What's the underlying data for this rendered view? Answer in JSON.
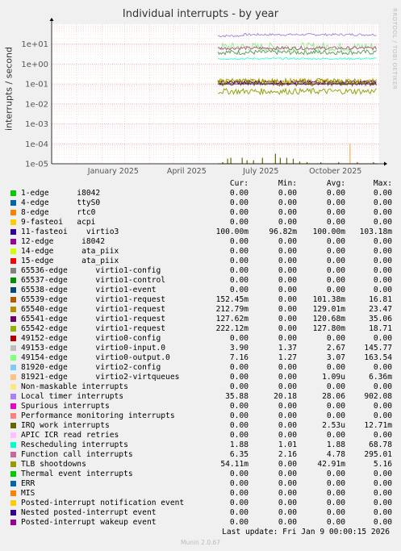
{
  "page": {
    "title": "Individual interrupts - by year",
    "side_text": "RRDTOOL / TOBI OETIKER",
    "ylabel": "interrupts / second",
    "last_update": "Last update: Fri Jan  9 00:00:15 2026",
    "footer": "Munin 2.0.67"
  },
  "chart_data": {
    "type": "line",
    "title": "Individual interrupts - by year",
    "ylabel": "interrupts / second",
    "y_scale": "log",
    "ylim": [
      1e-05,
      100
    ],
    "y_ticks": [
      "1e+01",
      "1e+00",
      "1e-01",
      "1e-02",
      "1e-03",
      "1e-04",
      "1e-05"
    ],
    "x_ticks": [
      "January 2025",
      "April 2025",
      "July 2025",
      "October 2025"
    ],
    "x_range": [
      "2024-12-01",
      "2026-01-09"
    ],
    "data_start": "2025-06-24",
    "grid": true,
    "series": [
      {
        "name": "Local timer interrupts",
        "color": "#a080e0",
        "level": 30,
        "spread": 0.06,
        "start_level": 26
      },
      {
        "name": "virtio0-input.0",
        "color": "#559955",
        "level": 3.9,
        "spread": 0.12
      },
      {
        "name": "virtio0-output.0",
        "color": "#88ee88",
        "level": 7.2,
        "spread": 0.22
      },
      {
        "name": "Function call interrupts",
        "color": "#b05080",
        "level": 6.3,
        "spread": 0.08
      },
      {
        "name": "Rescheduling interrupts",
        "color": "#33ffcc",
        "level": 1.88,
        "spread": 0.05
      },
      {
        "name": "virtio1-request 65539",
        "color": "#a05000",
        "level": 0.11,
        "spread": 0.14
      },
      {
        "name": "virtio1-request 65540",
        "color": "#c8a000",
        "level": 0.13,
        "spread": 0.16
      },
      {
        "name": "virtio1-request 65541",
        "color": "#550077",
        "level": 0.12,
        "spread": 0.1
      },
      {
        "name": "virtio1-request 65542",
        "color": "#88a000",
        "level": 0.13,
        "spread": 0.16
      },
      {
        "name": "11-fasteoi virtio3",
        "color": "#2a0088",
        "level": 0.1,
        "spread": 0.0
      },
      {
        "name": "TLB shootdowns",
        "color": "#88a000",
        "level": 0.043,
        "spread": 0.15
      }
    ],
    "spikes": {
      "color": "#666600",
      "base": 1e-05,
      "events": [
        {
          "date": "2025-06-30",
          "value": 1.2e-05
        },
        {
          "date": "2025-07-06",
          "value": 1.8e-05
        },
        {
          "date": "2025-07-10",
          "value": 2e-05
        },
        {
          "date": "2025-07-24",
          "value": 2e-05
        },
        {
          "date": "2025-07-30",
          "value": 1.5e-05
        },
        {
          "date": "2025-08-07",
          "value": 1.5e-05
        },
        {
          "date": "2025-08-18",
          "value": 2e-05
        },
        {
          "date": "2025-09-03",
          "value": 3.2e-05
        },
        {
          "date": "2025-09-09",
          "value": 2e-05
        },
        {
          "date": "2025-09-17",
          "value": 2e-05
        },
        {
          "date": "2025-09-25",
          "value": 1.8e-05
        },
        {
          "date": "2025-10-03",
          "value": 1.3e-05
        },
        {
          "date": "2025-10-12",
          "value": 1.2e-05
        },
        {
          "date": "2025-10-29",
          "value": 1.2e-05
        },
        {
          "date": "2025-11-20",
          "value": 1.2e-05
        },
        {
          "date": "2025-12-13",
          "value": 1.2e-05
        },
        {
          "date": "2026-01-02",
          "value": 1.2e-05
        }
      ],
      "orange_spike": {
        "date": "2025-12-04",
        "value": 0.0001,
        "color": "#ffaa55"
      }
    }
  },
  "legend": {
    "headers": {
      "cur": "Cur:",
      "min": "Min:",
      "avg": "Avg:",
      "max": "Max:"
    },
    "rows": [
      {
        "color": "#00cc00",
        "label": "1-edge      i8042",
        "cur": "0.00",
        "min": "0.00",
        "avg": "0.00",
        "max": "0.00"
      },
      {
        "color": "#0066b3",
        "label": "4-edge      ttyS0",
        "cur": "0.00",
        "min": "0.00",
        "avg": "0.00",
        "max": "0.00"
      },
      {
        "color": "#ff8000",
        "label": "8-edge      rtc0",
        "cur": "0.00",
        "min": "0.00",
        "avg": "0.00",
        "max": "0.00"
      },
      {
        "color": "#ffcc00",
        "label": "9-fasteoi   acpi",
        "cur": "0.00",
        "min": "0.00",
        "avg": "0.00",
        "max": "0.00"
      },
      {
        "color": "#330099",
        "label": "11-fasteoi    virtio3",
        "cur": "100.00m",
        "min": "96.82m",
        "avg": "100.00m",
        "max": "103.18m"
      },
      {
        "color": "#990099",
        "label": "12-edge      i8042",
        "cur": "0.00",
        "min": "0.00",
        "avg": "0.00",
        "max": "0.00"
      },
      {
        "color": "#ccff00",
        "label": "14-edge      ata_piix",
        "cur": "0.00",
        "min": "0.00",
        "avg": "0.00",
        "max": "0.00"
      },
      {
        "color": "#ff0000",
        "label": "15-edge      ata_piix",
        "cur": "0.00",
        "min": "0.00",
        "avg": "0.00",
        "max": "0.00"
      },
      {
        "color": "#808080",
        "label": "65536-edge      virtio1-config",
        "cur": "0.00",
        "min": "0.00",
        "avg": "0.00",
        "max": "0.00"
      },
      {
        "color": "#008f00",
        "label": "65537-edge      virtio1-control",
        "cur": "0.00",
        "min": "0.00",
        "avg": "0.00",
        "max": "0.00"
      },
      {
        "color": "#00487d",
        "label": "65538-edge      virtio1-event",
        "cur": "0.00",
        "min": "0.00",
        "avg": "0.00",
        "max": "0.00"
      },
      {
        "color": "#b35a00",
        "label": "65539-edge      virtio1-request",
        "cur": "152.45m",
        "min": "0.00",
        "avg": "101.38m",
        "max": "16.81"
      },
      {
        "color": "#b38f00",
        "label": "65540-edge      virtio1-request",
        "cur": "212.79m",
        "min": "0.00",
        "avg": "129.01m",
        "max": "23.47"
      },
      {
        "color": "#6b006b",
        "label": "65541-edge      virtio1-request",
        "cur": "127.62m",
        "min": "0.00",
        "avg": "120.68m",
        "max": "35.06"
      },
      {
        "color": "#8fb300",
        "label": "65542-edge      virtio1-request",
        "cur": "222.12m",
        "min": "0.00",
        "avg": "127.80m",
        "max": "18.71"
      },
      {
        "color": "#b30000",
        "label": "49152-edge      virtio0-config",
        "cur": "0.00",
        "min": "0.00",
        "avg": "0.00",
        "max": "0.00"
      },
      {
        "color": "#bebebe",
        "label": "49153-edge      virtio0-input.0",
        "cur": "3.90",
        "min": "1.37",
        "avg": "2.67",
        "max": "145.77"
      },
      {
        "color": "#80ff80",
        "label": "49154-edge      virtio0-output.0",
        "cur": "7.16",
        "min": "1.27",
        "avg": "3.07",
        "max": "163.54"
      },
      {
        "color": "#80c9ff",
        "label": "81920-edge      virtio2-config",
        "cur": "0.00",
        "min": "0.00",
        "avg": "0.00",
        "max": "0.00"
      },
      {
        "color": "#ffc080",
        "label": "81921-edge      virtio2-virtqueues",
        "cur": "0.00",
        "min": "0.00",
        "avg": "1.09u",
        "max": "6.36m"
      },
      {
        "color": "#ffe680",
        "label": "Non-maskable interrupts",
        "cur": "0.00",
        "min": "0.00",
        "avg": "0.00",
        "max": "0.00"
      },
      {
        "color": "#aa80ff",
        "label": "Local timer interrupts",
        "cur": "35.88",
        "min": "20.18",
        "avg": "28.06",
        "max": "902.08"
      },
      {
        "color": "#ee00cc",
        "label": "Spurious interrupts",
        "cur": "0.00",
        "min": "0.00",
        "avg": "0.00",
        "max": "0.00"
      },
      {
        "color": "#ff8080",
        "label": "Performance monitoring interrupts",
        "cur": "0.00",
        "min": "0.00",
        "avg": "0.00",
        "max": "0.00"
      },
      {
        "color": "#666600",
        "label": "IRQ work interrupts",
        "cur": "0.00",
        "min": "0.00",
        "avg": "2.53u",
        "max": "12.71m"
      },
      {
        "color": "#ffbfff",
        "label": "APIC ICR read retries",
        "cur": "0.00",
        "min": "0.00",
        "avg": "0.00",
        "max": "0.00"
      },
      {
        "color": "#00ffcc",
        "label": "Rescheduling interrupts",
        "cur": "1.88",
        "min": "1.01",
        "avg": "1.88",
        "max": "68.78"
      },
      {
        "color": "#cc6699",
        "label": "Function call interrupts",
        "cur": "6.35",
        "min": "2.16",
        "avg": "4.78",
        "max": "295.01"
      },
      {
        "color": "#999900",
        "label": "TLB shootdowns",
        "cur": "54.11m",
        "min": "0.00",
        "avg": "42.91m",
        "max": "5.16"
      },
      {
        "color": "#00cc00",
        "label": "Thermal event interrupts",
        "cur": "0.00",
        "min": "0.00",
        "avg": "0.00",
        "max": "0.00"
      },
      {
        "color": "#0066b3",
        "label": "ERR",
        "cur": "0.00",
        "min": "0.00",
        "avg": "0.00",
        "max": "0.00"
      },
      {
        "color": "#ff8000",
        "label": "MIS",
        "cur": "0.00",
        "min": "0.00",
        "avg": "0.00",
        "max": "0.00"
      },
      {
        "color": "#ffcc00",
        "label": "Posted-interrupt notification event",
        "cur": "0.00",
        "min": "0.00",
        "avg": "0.00",
        "max": "0.00"
      },
      {
        "color": "#330099",
        "label": "Nested posted-interrupt event",
        "cur": "0.00",
        "min": "0.00",
        "avg": "0.00",
        "max": "0.00"
      },
      {
        "color": "#990099",
        "label": "Posted-interrupt wakeup event",
        "cur": "0.00",
        "min": "0.00",
        "avg": "0.00",
        "max": "0.00"
      }
    ]
  }
}
